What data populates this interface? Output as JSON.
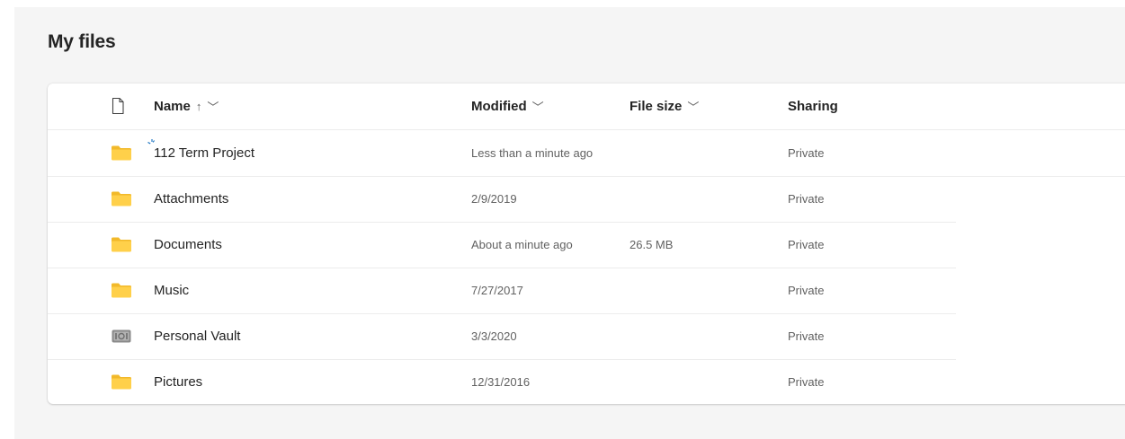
{
  "page": {
    "title": "My files"
  },
  "columns": {
    "name": {
      "label": "Name",
      "sort_icon": "arrow-up",
      "menu_icon": "chevron-down"
    },
    "modified": {
      "label": "Modified",
      "menu_icon": "chevron-down"
    },
    "file_size": {
      "label": "File size",
      "menu_icon": "chevron-down"
    },
    "sharing": {
      "label": "Sharing"
    },
    "file_type_icon": "document-icon"
  },
  "rows": [
    {
      "name": "112 Term Project",
      "modified": "Less than a minute ago",
      "file_size": "",
      "sharing": "Private",
      "icon": "folder-icon",
      "syncing": true
    },
    {
      "name": "Attachments",
      "modified": "2/9/2019",
      "file_size": "",
      "sharing": "Private",
      "icon": "folder-icon"
    },
    {
      "name": "Documents",
      "modified": "About a minute ago",
      "file_size": "26.5 MB",
      "sharing": "Private",
      "icon": "folder-icon"
    },
    {
      "name": "Music",
      "modified": "7/27/2017",
      "file_size": "",
      "sharing": "Private",
      "icon": "folder-icon"
    },
    {
      "name": "Personal Vault",
      "modified": "3/3/2020",
      "file_size": "",
      "sharing": "Private",
      "icon": "vault-icon"
    },
    {
      "name": "Pictures",
      "modified": "12/31/2016",
      "file_size": "",
      "sharing": "Private",
      "icon": "folder-icon"
    }
  ],
  "colors": {
    "folder": "#ffd04a",
    "folder_tab": "#f2b92a",
    "vault": "#8a8a8a",
    "sync_accent": "#0f6cbd",
    "background": "#f5f5f5"
  }
}
